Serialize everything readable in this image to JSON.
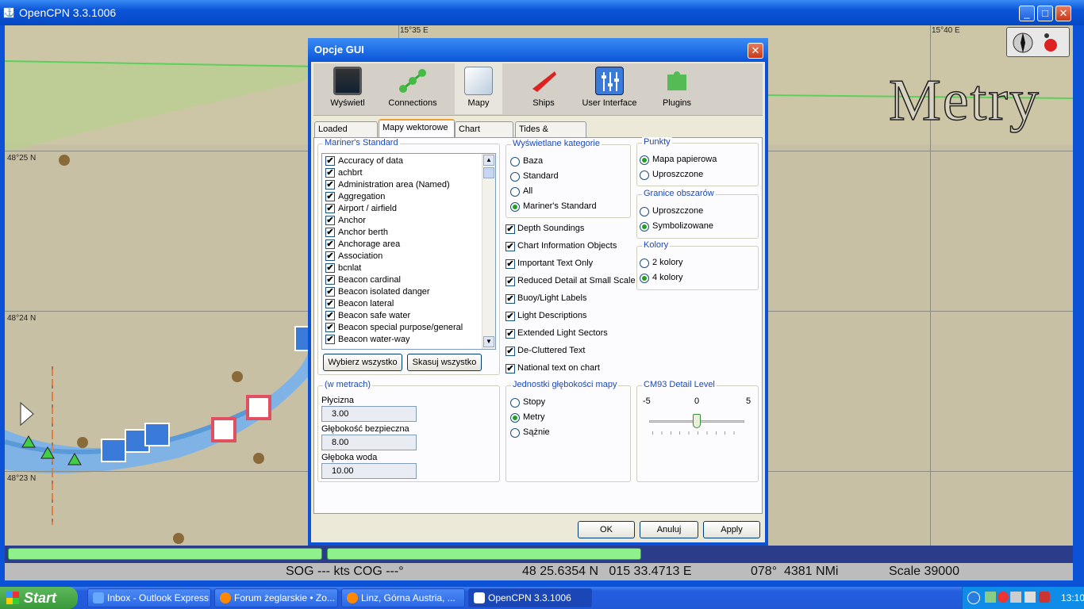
{
  "window": {
    "title": "OpenCPN 3.3.1006",
    "min": "_",
    "max": "□",
    "close": "✕"
  },
  "chart": {
    "coords": {
      "top1": "15°35 E",
      "top2": "15°40 E",
      "lat1": "48°25 N",
      "lat2": "48°24 N",
      "lat3": "48°23 N"
    },
    "unit_overlay": "Metry"
  },
  "status": {
    "sog": "SOG --- kts COG ---°",
    "position": "48 25.6354 N   015 33.4713 E",
    "bearing": "078°  4381 NMi",
    "scale": "Scale 39000"
  },
  "progress": [
    0.29,
    0.29
  ],
  "dialog": {
    "title": "Opcje GUI",
    "close": "✕",
    "toolbar": [
      {
        "label": "Wyświetl",
        "icon": "monitor-icon"
      },
      {
        "label": "Connections",
        "icon": "connections-icon"
      },
      {
        "label": "Mapy",
        "icon": "charts-icon"
      },
      {
        "label": "Ships",
        "icon": "ship-icon"
      },
      {
        "label": "User Interface",
        "icon": "sliders-icon"
      },
      {
        "label": "Plugins",
        "icon": "puzzle-icon"
      }
    ],
    "tabs": [
      "Loaded Charts",
      "Mapy wektorowe",
      "Chart Groups",
      "Tides & Currents"
    ],
    "mariners": {
      "label": "Mariner's Standard",
      "items": [
        "Accuracy of data",
        "achbrt",
        "Administration area (Named)",
        "Aggregation",
        "Airport / airfield",
        "Anchor",
        "Anchor berth",
        "Anchorage area",
        "Association",
        "bcnlat",
        "Beacon cardinal",
        "Beacon isolated danger",
        "Beacon lateral",
        "Beacon safe water",
        "Beacon special purpose/general",
        "Beacon water-way"
      ],
      "select_all": "Wybierz wszystko",
      "clear_all": "Skasuj wszystko"
    },
    "categories": {
      "label": "Wyświetlane kategorie",
      "options": [
        "Baza",
        "Standard",
        "All",
        "Mariner's Standard"
      ],
      "selected": 3
    },
    "checks": [
      "Depth Soundings",
      "Chart Information Objects",
      "Important Text Only",
      "Reduced Detail at Small Scale",
      "Buoy/Light Labels",
      "Light Descriptions",
      "Extended Light Sectors",
      "De-Cluttered Text",
      "National text on chart"
    ],
    "points": {
      "label": "Punkty",
      "options": [
        "Mapa papierowa",
        "Uproszczone"
      ],
      "selected": 0
    },
    "bounds": {
      "label": "Granice obszarów",
      "options": [
        "Uproszczone",
        "Symbolizowane"
      ],
      "selected": 1
    },
    "colors": {
      "label": "Kolory",
      "options": [
        "2 kolory",
        "4 kolory"
      ],
      "selected": 1
    },
    "depths": {
      "label": "(w metrach)",
      "shallow_label": "Płycizna",
      "shallow": "3.00",
      "safety_label": "Głębokość bezpieczna",
      "safety": "8.00",
      "deep_label": "Głęboka woda",
      "deep": "10.00"
    },
    "depth_units": {
      "label": "Jednostki głębokości mapy",
      "options": [
        "Stopy",
        "Metry",
        "Sążnie"
      ],
      "selected": 1
    },
    "cm93": {
      "label": "CM93 Detail Level",
      "min": "-5",
      "mid": "0",
      "max": "5",
      "value": 0
    },
    "buttons": {
      "ok": "OK",
      "cancel": "Anuluj",
      "apply": "Apply"
    }
  },
  "taskbar": {
    "start": "Start",
    "tasks": [
      "Inbox - Outlook Express",
      "Forum żeglarskie • Zo...",
      "Linz, Górna Austria, ...",
      "OpenCPN 3.3.1006"
    ],
    "clock": "13:10"
  }
}
